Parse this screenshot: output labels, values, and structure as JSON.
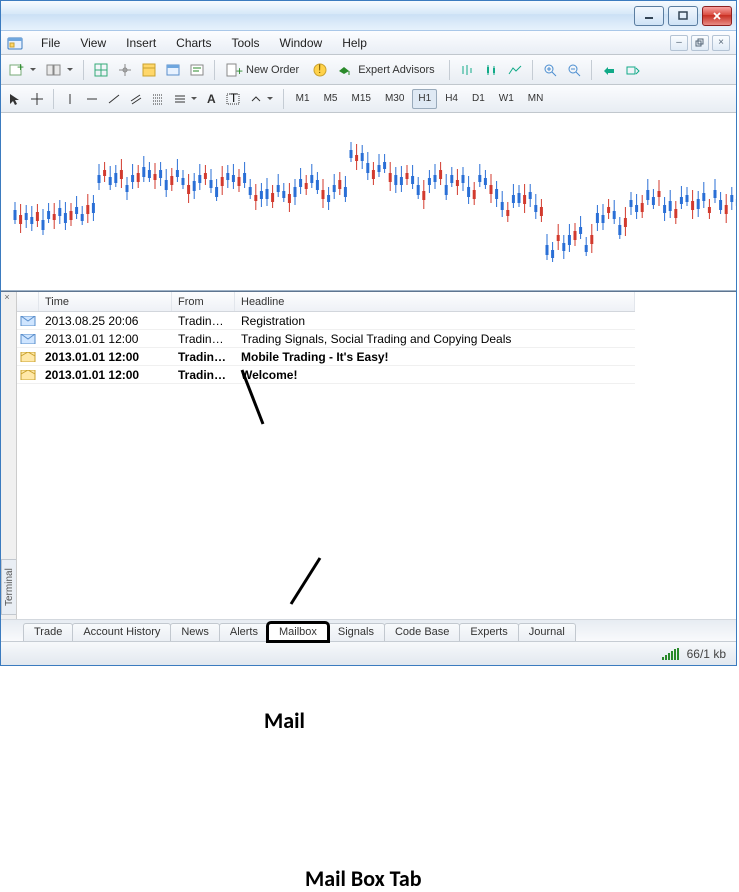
{
  "menus": {
    "file": "File",
    "view": "View",
    "insert": "Insert",
    "charts": "Charts",
    "tools": "Tools",
    "window": "Window",
    "help": "Help"
  },
  "toolbar": {
    "newOrder": "New Order",
    "expertAdvisors": "Expert Advisors"
  },
  "timeframes": [
    "M1",
    "M5",
    "M15",
    "M30",
    "H1",
    "H4",
    "D1",
    "W1",
    "MN"
  ],
  "terminal": {
    "title": "Terminal",
    "columns": {
      "time": "Time",
      "from": "From",
      "headline": "Headline"
    },
    "rows": [
      {
        "time": "2013.08.25 20:06",
        "from": "Trading ...",
        "headline": "Registration",
        "unread": false,
        "open": true
      },
      {
        "time": "2013.01.01 12:00",
        "from": "Trading ...",
        "headline": "Trading Signals, Social Trading and Copying Deals",
        "unread": false,
        "open": true
      },
      {
        "time": "2013.01.01 12:00",
        "from": "Trading ...",
        "headline": "Mobile Trading - It's Easy!",
        "unread": true,
        "open": false
      },
      {
        "time": "2013.01.01 12:00",
        "from": "Trading ...",
        "headline": "Welcome!",
        "unread": true,
        "open": false
      }
    ],
    "tabs": [
      "Trade",
      "Account History",
      "News",
      "Alerts",
      "Mailbox",
      "Signals",
      "Code Base",
      "Experts",
      "Journal"
    ],
    "activeTab": "Mailbox"
  },
  "status": {
    "kb": "66/1 kb"
  },
  "annot": {
    "mail": "Mail",
    "mailboxTab": "Mail Box Tab"
  }
}
